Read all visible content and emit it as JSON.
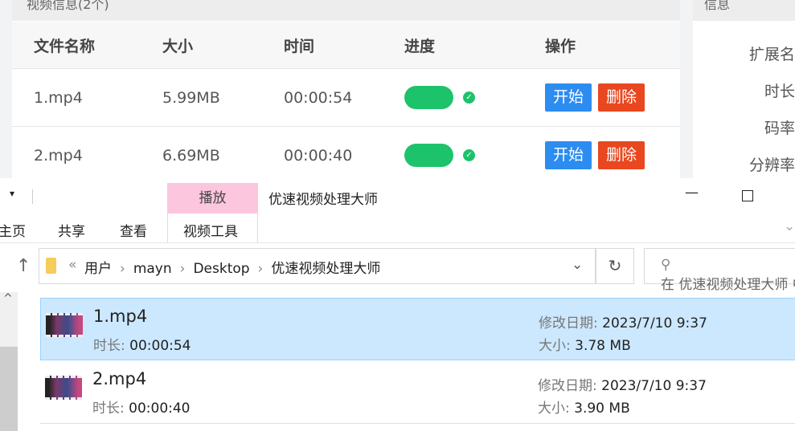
{
  "app": {
    "panel_title": "视频信息(2个)",
    "headers": [
      "文件名称",
      "大小",
      "时间",
      "进度",
      "操作"
    ],
    "rows": [
      {
        "name": "1.mp4",
        "size": "5.99MB",
        "time": "00:00:54",
        "progress": 100,
        "start": "开始",
        "delete": "删除"
      },
      {
        "name": "2.mp4",
        "size": "6.69MB",
        "time": "00:00:40",
        "progress": 100,
        "start": "开始",
        "delete": "删除"
      }
    ],
    "info_title": "信息",
    "info_labels": [
      "扩展名",
      "时长",
      "码率",
      "分辨率"
    ]
  },
  "explorer": {
    "context_tab": "播放",
    "title": "优速视频处理大师",
    "tabs": [
      "主页",
      "共享",
      "查看",
      "视频工具"
    ],
    "breadcrumb": [
      "用户",
      "mayn",
      "Desktop",
      "优速视频处理大师"
    ],
    "search_placeholder": "在 优速视频处理大师 中搜索",
    "files": [
      {
        "name": "1.mp4",
        "duration_label": "时长:",
        "duration": "00:00:54",
        "date_label": "修改日期:",
        "date": "2023/7/10 9:37",
        "size_label": "大小:",
        "size": "3.78 MB",
        "selected": true
      },
      {
        "name": "2.mp4",
        "duration_label": "时长:",
        "duration": "00:00:40",
        "date_label": "修改日期:",
        "date": "2023/7/10 9:37",
        "size_label": "大小:",
        "size": "3.90 MB",
        "selected": false
      }
    ]
  }
}
